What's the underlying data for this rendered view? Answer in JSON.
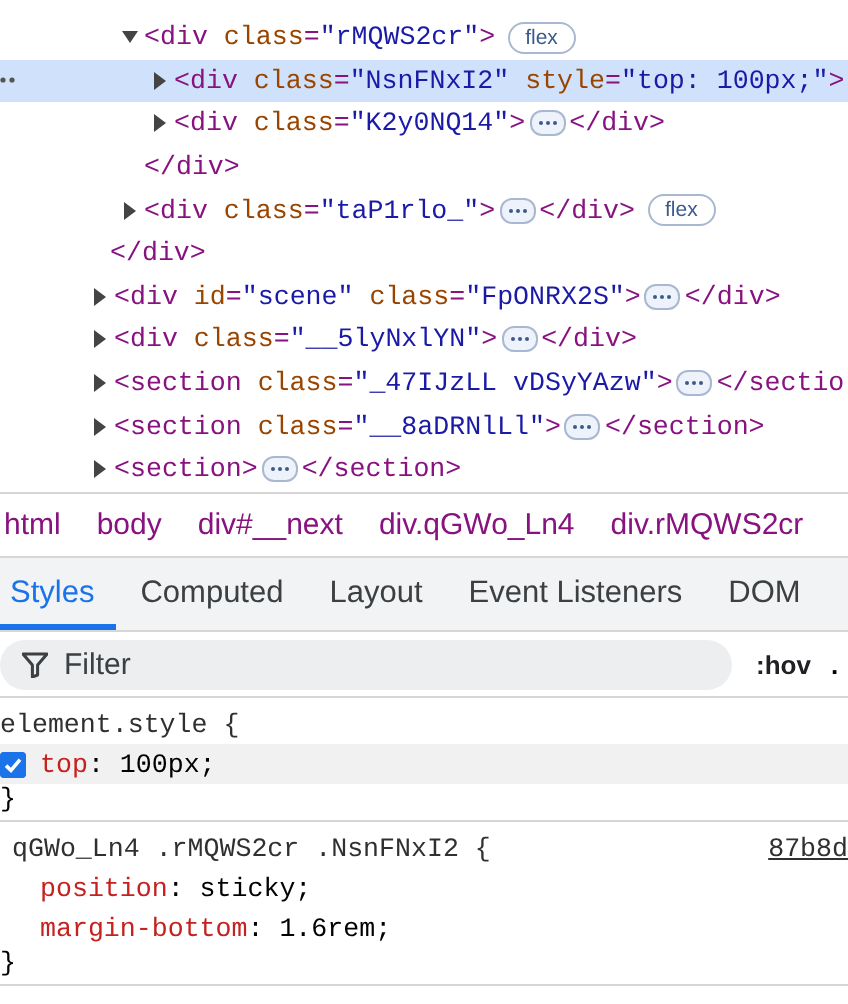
{
  "elements": [
    {
      "children": [
        {
          "open_tag": "<div class=\"rMQWS2cr\">",
          "expanded": true,
          "selected": false,
          "badge": "flex",
          "close_tag": "</div>",
          "children": [
            {
              "open_tag": "<div class=\"NsnFNxI2\" style=\"top: 100px;\">",
              "expanded": false,
              "selected": true
            },
            {
              "open_tag": "<div class=\"K2y0NQ14\">",
              "expanded": false,
              "selected": false,
              "close_tag": "</div>"
            }
          ]
        },
        {
          "open_tag": "<div class=\"taP1rlo_\">",
          "expanded": false,
          "selected": false,
          "close_tag": "</div>",
          "badge": "flex"
        }
      ],
      "close_tag": "</div>"
    },
    {
      "open_tag": "<div id=\"scene\" class=\"FpONRX2S\">",
      "expanded": false,
      "selected": false,
      "close_tag": "</div>"
    },
    {
      "open_tag": "<div class=\"__5lyNxlYN\">",
      "expanded": false,
      "selected": false,
      "close_tag": "</div>"
    },
    {
      "open_tag": "<section class=\"_47IJzLL vDSyYAzw\">",
      "expanded": false,
      "selected": false,
      "close_tag": "</sectio"
    },
    {
      "open_tag": "<section class=\"__8aDRNlLl\">",
      "expanded": false,
      "selected": false,
      "close_tag": "</section>"
    },
    {
      "open_tag": "<section>",
      "expanded": false,
      "selected": false,
      "close_tag": "</section>"
    }
  ],
  "breadcrumbs": [
    "html",
    "body",
    "div#__next",
    "div.qGWo_Ln4",
    "div.rMQWS2cr"
  ],
  "tabs": [
    {
      "label": "Styles",
      "selected": true
    },
    {
      "label": "Computed",
      "selected": false
    },
    {
      "label": "Layout",
      "selected": false
    },
    {
      "label": "Event Listeners",
      "selected": false
    },
    {
      "label": "DOM",
      "selected": false
    }
  ],
  "filter": {
    "placeholder": "Filter",
    "hov": ":hov",
    "more": "."
  },
  "rules": [
    {
      "selector": "element.style {",
      "properties": [
        {
          "declaration": "top: 100px;",
          "checked": true
        }
      ],
      "close": "}"
    },
    {
      "selector": "qGWo_Ln4 .rMQWS2cr .NsnFNxI2 {",
      "source": "87b8d",
      "properties": [
        {
          "declaration": "position: sticky;"
        },
        {
          "declaration": "margin-bottom: 1.6rem;"
        }
      ],
      "close": "}"
    }
  ]
}
